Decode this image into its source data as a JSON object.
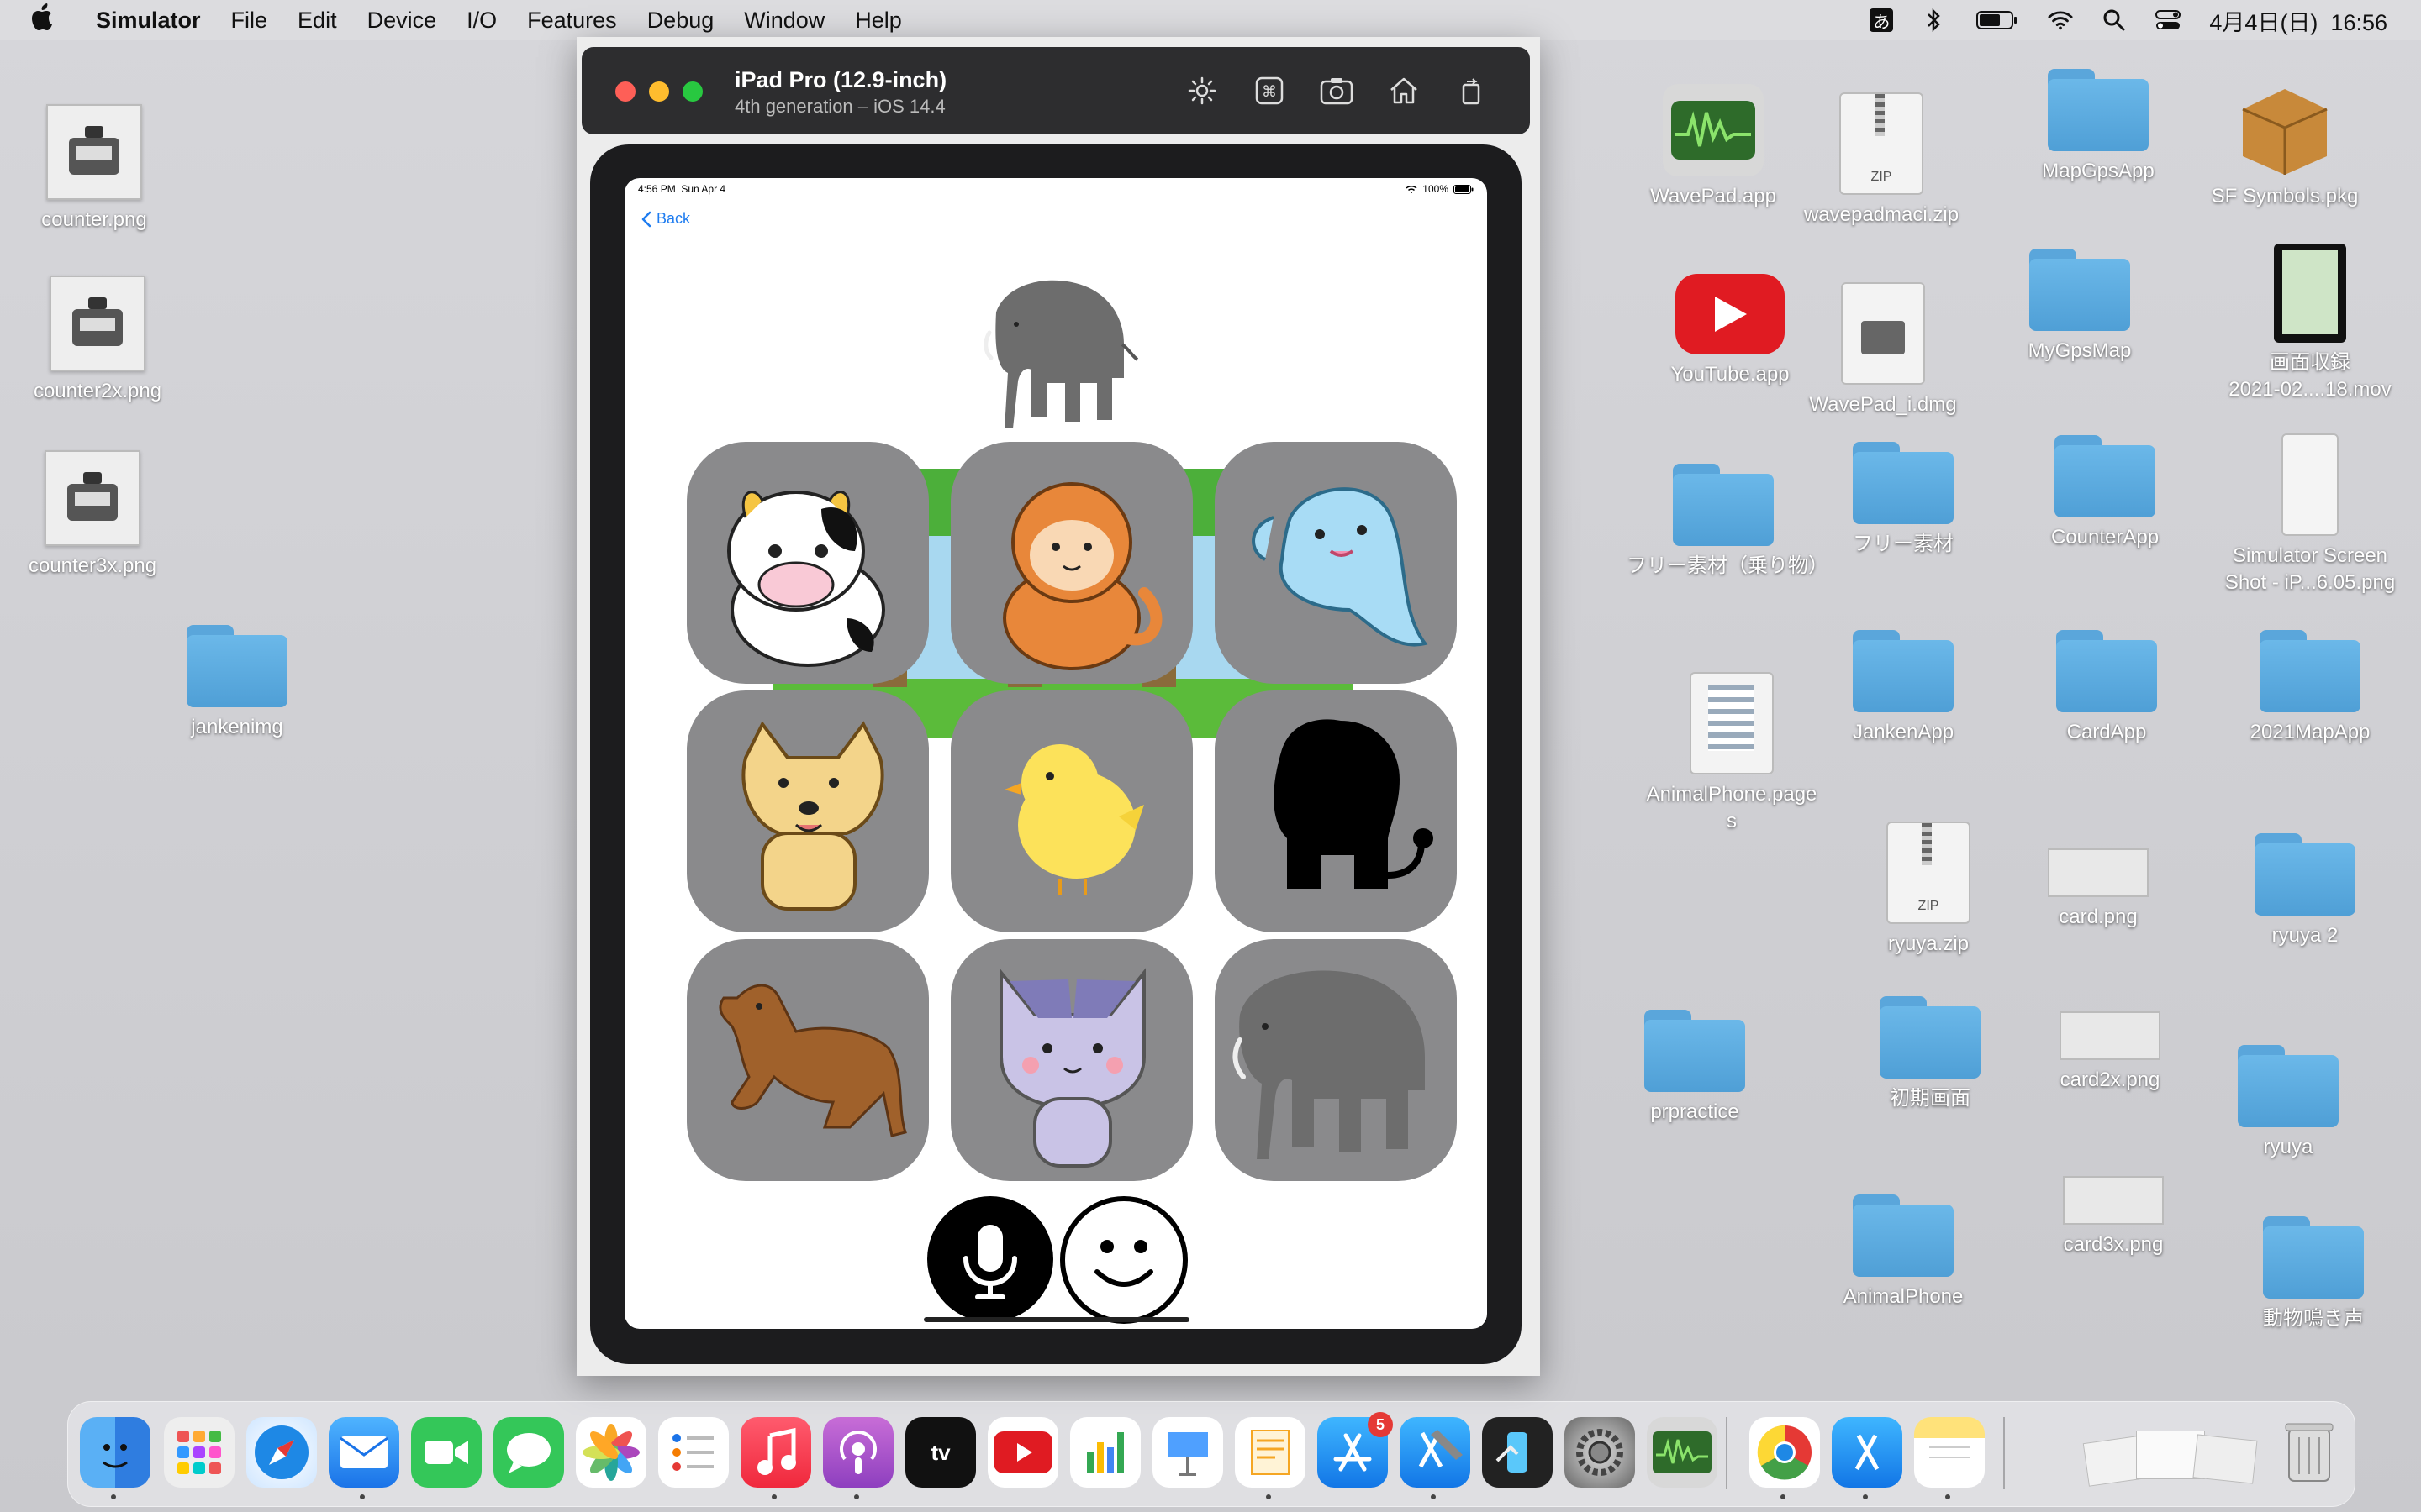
{
  "menubar": {
    "app_name": "Simulator",
    "menus": [
      "File",
      "Edit",
      "Device",
      "I/O",
      "Features",
      "Debug",
      "Window",
      "Help"
    ],
    "input_method": "あ",
    "datetime": "4月4日(日)  16:56"
  },
  "desktop": {
    "left_icons": [
      {
        "label": "counter.png"
      },
      {
        "label": "counter2x.png"
      },
      {
        "label": "counter3x.png"
      },
      {
        "label": "jankenimg"
      }
    ],
    "right_icons": [
      {
        "label": "WavePad.app"
      },
      {
        "label": "wavepadmaci.zip"
      },
      {
        "label": "MapGpsApp"
      },
      {
        "label": "SF Symbols.pkg"
      },
      {
        "label": "YouTube.app"
      },
      {
        "label": "WavePad_i.dmg"
      },
      {
        "label": "MyGpsMap"
      },
      {
        "label": "画面収録\n2021-02....18.mov"
      },
      {
        "label": "フリー素材（乗り物）"
      },
      {
        "label": "フリー素材"
      },
      {
        "label": "CounterApp"
      },
      {
        "label": "Simulator Screen\nShot - iP...6.05.png"
      },
      {
        "label": "AnimalPhone.page\ns"
      },
      {
        "label": "JankenApp"
      },
      {
        "label": "CardApp"
      },
      {
        "label": "2021MapApp"
      },
      {
        "label": "ryuya.zip"
      },
      {
        "label": "card.png"
      },
      {
        "label": "ryuya 2"
      },
      {
        "label": "prpractice"
      },
      {
        "label": "初期画面"
      },
      {
        "label": "card2x.png"
      },
      {
        "label": "ryuya"
      },
      {
        "label": "AnimalPhone"
      },
      {
        "label": "card3x.png"
      },
      {
        "label": "動物鳴き声"
      }
    ],
    "zip_badge": "ZIP"
  },
  "simulator": {
    "device_name": "iPad Pro (12.9-inch)",
    "device_sub": "4th generation – iOS 14.4"
  },
  "ipad": {
    "status_time": "4:56 PM",
    "status_date": "Sun Apr 4",
    "battery": "100%",
    "back_label": "Back"
  },
  "dock": {
    "badge_count": "5"
  },
  "colors": {
    "tile_gray": "#8a8a8c",
    "ios_blue": "#1e7cf0",
    "folder_blue": "#5aa6db"
  }
}
